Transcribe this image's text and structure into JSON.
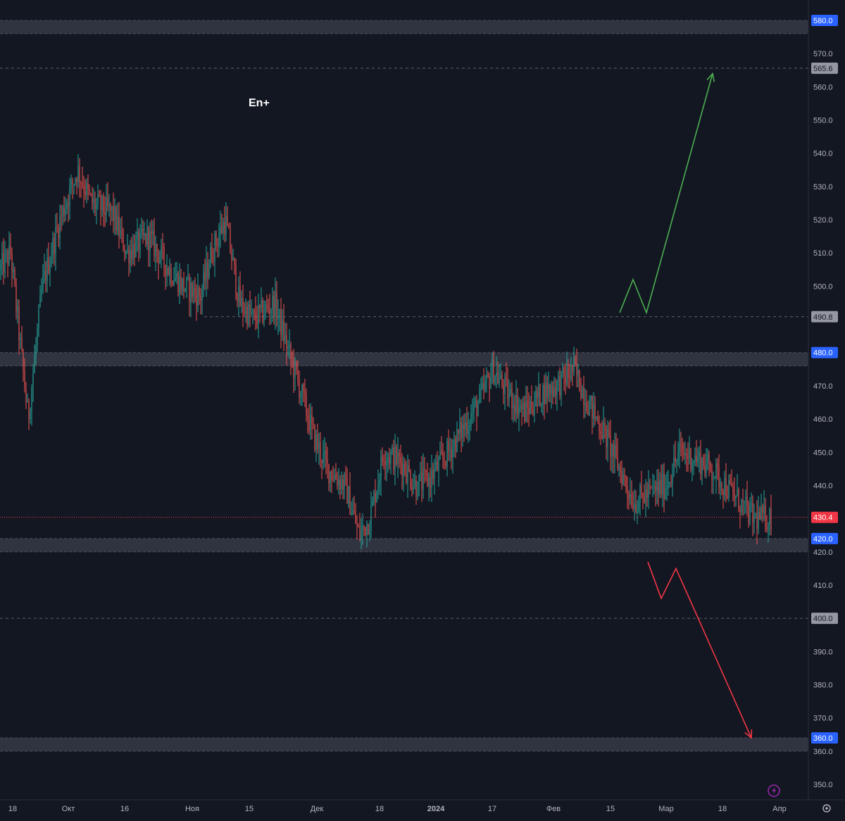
{
  "chart_data": {
    "type": "candlestick",
    "title": "En+",
    "ylim": [
      343,
      583
    ],
    "y_ticks": [
      350,
      360,
      370,
      380,
      390,
      400,
      410,
      420,
      430,
      440,
      450,
      460,
      470,
      480,
      490,
      500,
      510,
      520,
      530,
      540,
      550,
      560,
      570,
      580
    ],
    "x_labels": [
      "18",
      "Окт",
      "16",
      "Ноя",
      "15",
      "Дек",
      "18",
      "2024",
      "17",
      "Фев",
      "15",
      "Мар",
      "18",
      "Апр"
    ],
    "current_price": 430.4,
    "last_price_label": "430.4",
    "zones": [
      {
        "low": 576,
        "high": 580,
        "label": "580.0"
      },
      {
        "low": 476,
        "high": 480,
        "label": "480.0"
      },
      {
        "low": 420,
        "high": 424,
        "label": "420.0"
      },
      {
        "low": 360,
        "high": 364,
        "label": "360.0"
      }
    ],
    "levels": [
      {
        "value": 565.6,
        "label": "565.6"
      },
      {
        "value": 490.8,
        "label": "490.8"
      },
      {
        "value": 400.0,
        "label": "400.0"
      }
    ],
    "price_path": [
      [
        0,
        505
      ],
      [
        15,
        510
      ],
      [
        40,
        460
      ],
      [
        60,
        500
      ],
      [
        85,
        520
      ],
      [
        110,
        535
      ],
      [
        130,
        525
      ],
      [
        160,
        522
      ],
      [
        180,
        510
      ],
      [
        210,
        515
      ],
      [
        240,
        505
      ],
      [
        260,
        500
      ],
      [
        285,
        497
      ],
      [
        300,
        510
      ],
      [
        320,
        520
      ],
      [
        340,
        495
      ],
      [
        360,
        490
      ],
      [
        390,
        495
      ],
      [
        410,
        480
      ],
      [
        425,
        470
      ],
      [
        445,
        455
      ],
      [
        465,
        445
      ],
      [
        490,
        440
      ],
      [
        510,
        425
      ],
      [
        525,
        430
      ],
      [
        545,
        450
      ],
      [
        570,
        447
      ],
      [
        590,
        440
      ],
      [
        610,
        442
      ],
      [
        630,
        448
      ],
      [
        660,
        458
      ],
      [
        680,
        465
      ],
      [
        700,
        475
      ],
      [
        720,
        468
      ],
      [
        745,
        462
      ],
      [
        770,
        468
      ],
      [
        790,
        470
      ],
      [
        815,
        475
      ],
      [
        835,
        465
      ],
      [
        860,
        455
      ],
      [
        880,
        445
      ],
      [
        900,
        435
      ],
      [
        925,
        438
      ],
      [
        945,
        440
      ],
      [
        965,
        450
      ],
      [
        990,
        448
      ],
      [
        1010,
        445
      ],
      [
        1030,
        440
      ],
      [
        1050,
        435
      ],
      [
        1070,
        430
      ],
      [
        1097,
        430.4
      ]
    ],
    "scenarios": [
      {
        "name": "up",
        "color": "#4caf50",
        "points": [
          [
            880,
            492
          ],
          [
            899,
            502
          ],
          [
            918,
            492
          ],
          [
            1012,
            564
          ]
        ]
      },
      {
        "name": "down",
        "color": "#f23645",
        "points": [
          [
            920,
            417
          ],
          [
            939,
            406
          ],
          [
            960,
            415
          ],
          [
            1067,
            364
          ]
        ]
      }
    ],
    "colors": {
      "background": "#131722",
      "up_candle": "#26a69a",
      "down_candle": "#ef5350",
      "zone_fill": "#363a45",
      "axis_text": "#b2b5be",
      "blue_badge": "#2962ff",
      "grey_badge": "#9598a1",
      "price_badge": "#f23645"
    },
    "icons": [
      "lightning-icon",
      "settings-icon"
    ]
  }
}
